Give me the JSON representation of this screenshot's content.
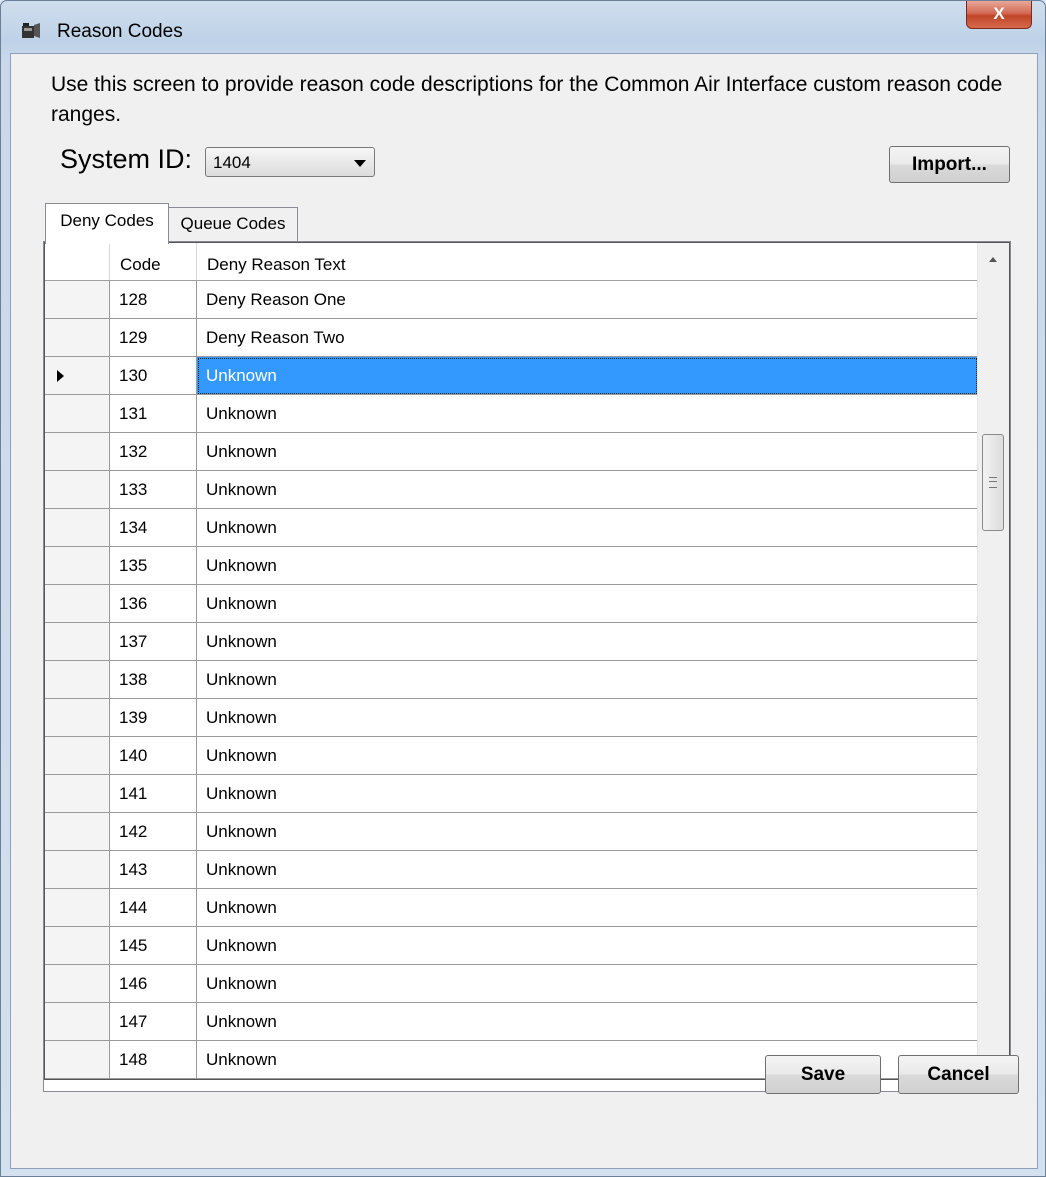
{
  "window": {
    "title": "Reason Codes",
    "close_label": "X"
  },
  "description": "Use this screen to provide reason code descriptions for the Common Air Interface custom reason code ranges.",
  "system": {
    "label": "System ID:",
    "selected": "1404"
  },
  "buttons": {
    "import": "Import...",
    "save": "Save",
    "cancel": "Cancel"
  },
  "tabs": [
    {
      "label": "Deny Codes",
      "active": true
    },
    {
      "label": "Queue Codes",
      "active": false
    }
  ],
  "grid": {
    "columns": [
      "Code",
      "Deny Reason Text"
    ],
    "rows": [
      {
        "code": "128",
        "text": "Deny Reason One"
      },
      {
        "code": "129",
        "text": "Deny Reason Two"
      },
      {
        "code": "130",
        "text": "Unknown",
        "selected": true
      },
      {
        "code": "131",
        "text": "Unknown"
      },
      {
        "code": "132",
        "text": "Unknown"
      },
      {
        "code": "133",
        "text": "Unknown"
      },
      {
        "code": "134",
        "text": "Unknown"
      },
      {
        "code": "135",
        "text": "Unknown"
      },
      {
        "code": "136",
        "text": "Unknown"
      },
      {
        "code": "137",
        "text": "Unknown"
      },
      {
        "code": "138",
        "text": "Unknown"
      },
      {
        "code": "139",
        "text": "Unknown"
      },
      {
        "code": "140",
        "text": "Unknown"
      },
      {
        "code": "141",
        "text": "Unknown"
      },
      {
        "code": "142",
        "text": "Unknown"
      },
      {
        "code": "143",
        "text": "Unknown"
      },
      {
        "code": "144",
        "text": "Unknown"
      },
      {
        "code": "145",
        "text": "Unknown"
      },
      {
        "code": "146",
        "text": "Unknown"
      },
      {
        "code": "147",
        "text": "Unknown"
      },
      {
        "code": "148",
        "text": "Unknown"
      }
    ]
  },
  "colors": {
    "selection": "#3399ff",
    "close_button": "#c04528"
  }
}
